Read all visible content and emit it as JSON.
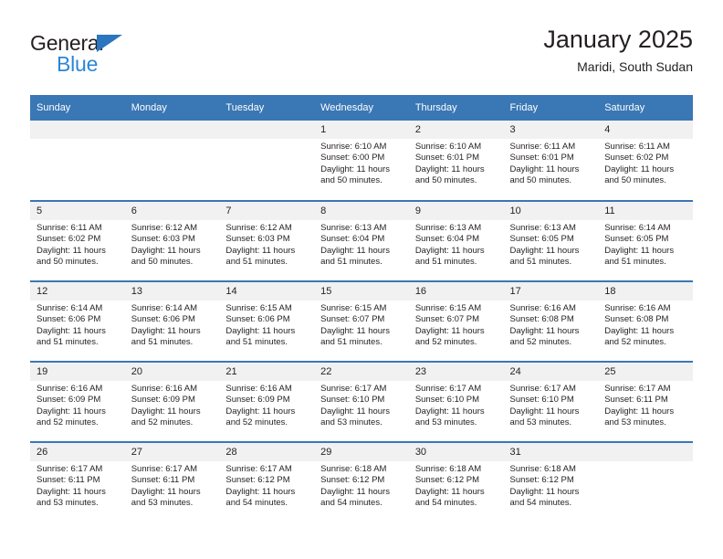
{
  "brand": {
    "name_top": "General",
    "name_bottom": "Blue",
    "triangle_color": "#2b76bf",
    "blue_text_color": "#2b86d6"
  },
  "header": {
    "title": "January 2025",
    "subtitle": "Maridi, South Sudan"
  },
  "theme": {
    "header_blue": "#3a77b5",
    "daynum_band": "#f1f1f1",
    "text": "#231f20"
  },
  "calendar": {
    "weekday_headers": [
      "Sunday",
      "Monday",
      "Tuesday",
      "Wednesday",
      "Thursday",
      "Friday",
      "Saturday"
    ],
    "labels": {
      "sunrise": "Sunrise:",
      "sunset": "Sunset:",
      "daylight": "Daylight:"
    },
    "weeks": [
      [
        {
          "day": "",
          "empty": true
        },
        {
          "day": "",
          "empty": true
        },
        {
          "day": "",
          "empty": true
        },
        {
          "day": "1",
          "sunrise": "Sunrise: 6:10 AM",
          "sunset": "Sunset: 6:00 PM",
          "daylight": "Daylight: 11 hours and 50 minutes."
        },
        {
          "day": "2",
          "sunrise": "Sunrise: 6:10 AM",
          "sunset": "Sunset: 6:01 PM",
          "daylight": "Daylight: 11 hours and 50 minutes."
        },
        {
          "day": "3",
          "sunrise": "Sunrise: 6:11 AM",
          "sunset": "Sunset: 6:01 PM",
          "daylight": "Daylight: 11 hours and 50 minutes."
        },
        {
          "day": "4",
          "sunrise": "Sunrise: 6:11 AM",
          "sunset": "Sunset: 6:02 PM",
          "daylight": "Daylight: 11 hours and 50 minutes."
        }
      ],
      [
        {
          "day": "5",
          "sunrise": "Sunrise: 6:11 AM",
          "sunset": "Sunset: 6:02 PM",
          "daylight": "Daylight: 11 hours and 50 minutes."
        },
        {
          "day": "6",
          "sunrise": "Sunrise: 6:12 AM",
          "sunset": "Sunset: 6:03 PM",
          "daylight": "Daylight: 11 hours and 50 minutes."
        },
        {
          "day": "7",
          "sunrise": "Sunrise: 6:12 AM",
          "sunset": "Sunset: 6:03 PM",
          "daylight": "Daylight: 11 hours and 51 minutes."
        },
        {
          "day": "8",
          "sunrise": "Sunrise: 6:13 AM",
          "sunset": "Sunset: 6:04 PM",
          "daylight": "Daylight: 11 hours and 51 minutes."
        },
        {
          "day": "9",
          "sunrise": "Sunrise: 6:13 AM",
          "sunset": "Sunset: 6:04 PM",
          "daylight": "Daylight: 11 hours and 51 minutes."
        },
        {
          "day": "10",
          "sunrise": "Sunrise: 6:13 AM",
          "sunset": "Sunset: 6:05 PM",
          "daylight": "Daylight: 11 hours and 51 minutes."
        },
        {
          "day": "11",
          "sunrise": "Sunrise: 6:14 AM",
          "sunset": "Sunset: 6:05 PM",
          "daylight": "Daylight: 11 hours and 51 minutes."
        }
      ],
      [
        {
          "day": "12",
          "sunrise": "Sunrise: 6:14 AM",
          "sunset": "Sunset: 6:06 PM",
          "daylight": "Daylight: 11 hours and 51 minutes."
        },
        {
          "day": "13",
          "sunrise": "Sunrise: 6:14 AM",
          "sunset": "Sunset: 6:06 PM",
          "daylight": "Daylight: 11 hours and 51 minutes."
        },
        {
          "day": "14",
          "sunrise": "Sunrise: 6:15 AM",
          "sunset": "Sunset: 6:06 PM",
          "daylight": "Daylight: 11 hours and 51 minutes."
        },
        {
          "day": "15",
          "sunrise": "Sunrise: 6:15 AM",
          "sunset": "Sunset: 6:07 PM",
          "daylight": "Daylight: 11 hours and 51 minutes."
        },
        {
          "day": "16",
          "sunrise": "Sunrise: 6:15 AM",
          "sunset": "Sunset: 6:07 PM",
          "daylight": "Daylight: 11 hours and 52 minutes."
        },
        {
          "day": "17",
          "sunrise": "Sunrise: 6:16 AM",
          "sunset": "Sunset: 6:08 PM",
          "daylight": "Daylight: 11 hours and 52 minutes."
        },
        {
          "day": "18",
          "sunrise": "Sunrise: 6:16 AM",
          "sunset": "Sunset: 6:08 PM",
          "daylight": "Daylight: 11 hours and 52 minutes."
        }
      ],
      [
        {
          "day": "19",
          "sunrise": "Sunrise: 6:16 AM",
          "sunset": "Sunset: 6:09 PM",
          "daylight": "Daylight: 11 hours and 52 minutes."
        },
        {
          "day": "20",
          "sunrise": "Sunrise: 6:16 AM",
          "sunset": "Sunset: 6:09 PM",
          "daylight": "Daylight: 11 hours and 52 minutes."
        },
        {
          "day": "21",
          "sunrise": "Sunrise: 6:16 AM",
          "sunset": "Sunset: 6:09 PM",
          "daylight": "Daylight: 11 hours and 52 minutes."
        },
        {
          "day": "22",
          "sunrise": "Sunrise: 6:17 AM",
          "sunset": "Sunset: 6:10 PM",
          "daylight": "Daylight: 11 hours and 53 minutes."
        },
        {
          "day": "23",
          "sunrise": "Sunrise: 6:17 AM",
          "sunset": "Sunset: 6:10 PM",
          "daylight": "Daylight: 11 hours and 53 minutes."
        },
        {
          "day": "24",
          "sunrise": "Sunrise: 6:17 AM",
          "sunset": "Sunset: 6:10 PM",
          "daylight": "Daylight: 11 hours and 53 minutes."
        },
        {
          "day": "25",
          "sunrise": "Sunrise: 6:17 AM",
          "sunset": "Sunset: 6:11 PM",
          "daylight": "Daylight: 11 hours and 53 minutes."
        }
      ],
      [
        {
          "day": "26",
          "sunrise": "Sunrise: 6:17 AM",
          "sunset": "Sunset: 6:11 PM",
          "daylight": "Daylight: 11 hours and 53 minutes."
        },
        {
          "day": "27",
          "sunrise": "Sunrise: 6:17 AM",
          "sunset": "Sunset: 6:11 PM",
          "daylight": "Daylight: 11 hours and 53 minutes."
        },
        {
          "day": "28",
          "sunrise": "Sunrise: 6:17 AM",
          "sunset": "Sunset: 6:12 PM",
          "daylight": "Daylight: 11 hours and 54 minutes."
        },
        {
          "day": "29",
          "sunrise": "Sunrise: 6:18 AM",
          "sunset": "Sunset: 6:12 PM",
          "daylight": "Daylight: 11 hours and 54 minutes."
        },
        {
          "day": "30",
          "sunrise": "Sunrise: 6:18 AM",
          "sunset": "Sunset: 6:12 PM",
          "daylight": "Daylight: 11 hours and 54 minutes."
        },
        {
          "day": "31",
          "sunrise": "Sunrise: 6:18 AM",
          "sunset": "Sunset: 6:12 PM",
          "daylight": "Daylight: 11 hours and 54 minutes."
        },
        {
          "day": "",
          "empty": true
        }
      ]
    ]
  }
}
